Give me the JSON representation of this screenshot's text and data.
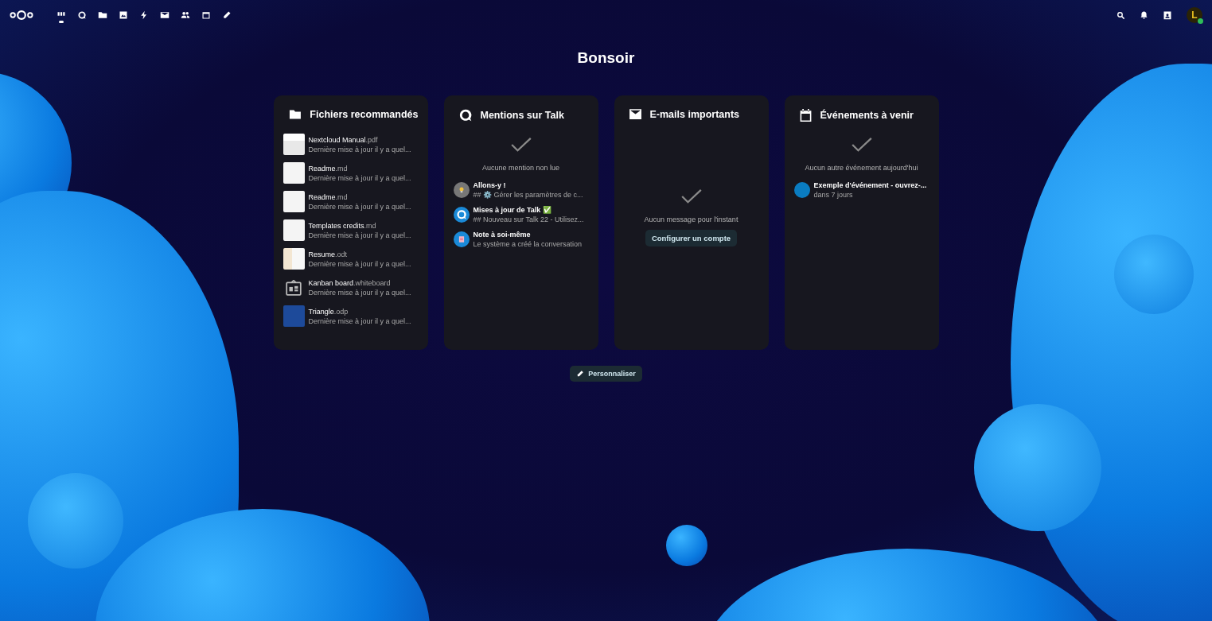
{
  "header": {
    "apps": [
      {
        "kind": "dashboard",
        "selected": true
      },
      {
        "kind": "talk",
        "selected": false
      },
      {
        "kind": "files",
        "selected": false
      },
      {
        "kind": "photos",
        "selected": false
      },
      {
        "kind": "activity",
        "selected": false
      },
      {
        "kind": "mail",
        "selected": false
      },
      {
        "kind": "contacts",
        "selected": false
      },
      {
        "kind": "calendar",
        "selected": false
      },
      {
        "kind": "edit",
        "selected": false
      }
    ],
    "avatar_initial": "L",
    "status_online": true
  },
  "greeting": "Bonsoir",
  "widgets": [
    {
      "kind": "files",
      "title": "Fichiers recommandés",
      "items": [
        {
          "kind": "manual",
          "name": "Nextcloud Manual",
          "ext": ".pdf",
          "subtitle": "Dernière mise à jour il y a quel..."
        },
        {
          "kind": "doc",
          "name": "Readme",
          "ext": ".md",
          "subtitle": "Dernière mise à jour il y a quel..."
        },
        {
          "kind": "doc",
          "name": "Readme",
          "ext": ".md",
          "subtitle": "Dernière mise à jour il y a quel..."
        },
        {
          "kind": "doc",
          "name": "Templates credits",
          "ext": ".md",
          "subtitle": "Dernière mise à jour il y a quel..."
        },
        {
          "kind": "resume",
          "name": "Resume",
          "ext": ".odt",
          "subtitle": "Dernière mise à jour il y a quel..."
        },
        {
          "kind": "whiteboard",
          "name": "Kanban board",
          "ext": ".whiteboard",
          "subtitle": "Dernière mise à jour il y a quel..."
        },
        {
          "kind": "slide",
          "name": "Triangle",
          "ext": ".odp",
          "subtitle": "Dernière mise à jour il y a quel..."
        }
      ]
    },
    {
      "kind": "talk",
      "title": "Mentions sur Talk",
      "empty": "Aucune mention non lue",
      "items": [
        {
          "kind": "bulb",
          "name": "Allons-y !",
          "subtitle": "## ⚙️ Gérer les paramètres de c..."
        },
        {
          "kind": "talk",
          "name": "Mises à jour de Talk ✅",
          "subtitle": "## Nouveau sur Talk 22 - Utilisez..."
        },
        {
          "kind": "note",
          "name": "Note à soi-même",
          "subtitle": "Le système a créé la conversation"
        }
      ]
    },
    {
      "kind": "mail",
      "title": "E-mails importants",
      "empty": "Aucun message pour l'instant",
      "action": "Configurer un compte"
    },
    {
      "kind": "calendar",
      "title": "Événements à venir",
      "empty": "Aucun autre événement aujourd'hui",
      "items": [
        {
          "color": "#0a7cc1",
          "name": "Exemple d'événement - ouvrez-...",
          "subtitle": "dans 7 jours"
        }
      ]
    }
  ],
  "customize_button": "Personnaliser"
}
